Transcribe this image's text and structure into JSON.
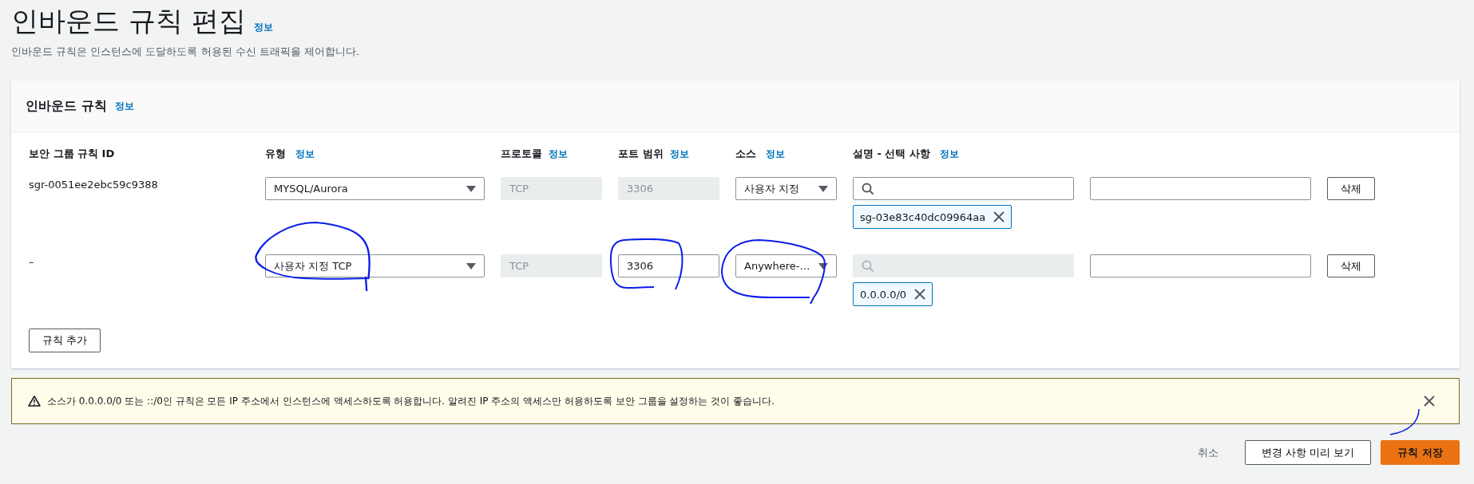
{
  "page": {
    "title": "인바운드 규칙 편집",
    "info_link": "정보",
    "description": "인바운드 규칙은 인스턴스에 도달하도록 허용된 수신 트래픽을 제어합니다."
  },
  "panel": {
    "title": "인바운드 규칙",
    "info_link": "정보",
    "columns": [
      {
        "label": "보안 그룹 규칙 ID"
      },
      {
        "label": "유형",
        "info_link": "정보"
      },
      {
        "label": "프로토콜",
        "info_link": "정보"
      },
      {
        "label": "포트 범위",
        "info_link": "정보"
      },
      {
        "label": "소스",
        "info_link": "정보"
      },
      {
        "label": "설명 - 선택 사항",
        "info_link": "정보"
      }
    ],
    "rows": [
      {
        "id": "sgr-0051ee2ebc59c9388",
        "type": "MYSQL/Aurora",
        "protocol": "TCP",
        "port": "3306",
        "port_disabled": true,
        "source": "사용자 지정",
        "search_disabled": false,
        "tokens": [
          "sg-03e83c40dc09964aa"
        ],
        "delete": "삭제",
        "annotated": false
      },
      {
        "id": "–",
        "type": "사용자 지정 TCP",
        "protocol": "TCP",
        "port": "3306",
        "port_disabled": false,
        "source": "Anywhere-…",
        "search_disabled": true,
        "tokens": [
          "0.0.0.0/0"
        ],
        "delete": "삭제",
        "annotated": true
      }
    ],
    "add_button": "규칙 추가"
  },
  "warning": {
    "message": "소스가 0.0.0.0/0 또는 ::/0인 규칙은 모든 IP 주소에서 인스턴스에 액세스하도록 허용합니다. 알려진 IP 주소의 액세스만 허용하도록 보안 그룹을 설정하는 것이 좋습니다."
  },
  "buttons": [
    {
      "label": "취소",
      "kind": "link"
    },
    {
      "label": "변경 사항 미리 보기",
      "kind": "secondary"
    },
    {
      "label": "규칙 저장",
      "kind": "primary"
    }
  ]
}
